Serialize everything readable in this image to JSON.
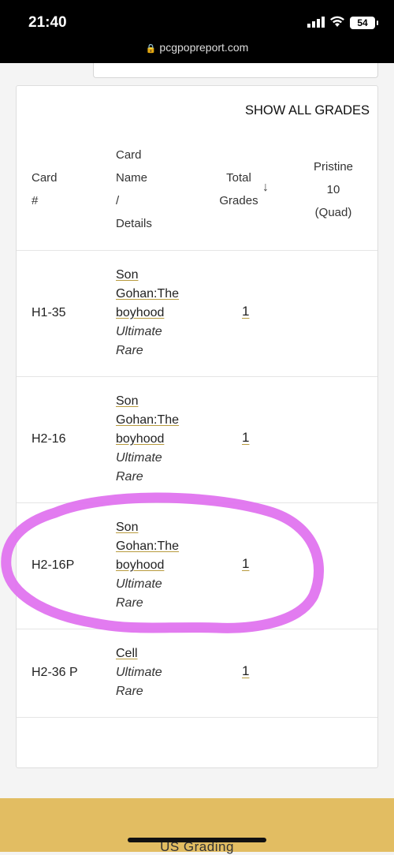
{
  "status_bar": {
    "time": "21:40",
    "battery": "54"
  },
  "browser": {
    "url": "pcgpopreport.com"
  },
  "table": {
    "show_all_label": "SHOW ALL GRADES",
    "headers": {
      "card_no": [
        "Card",
        "#"
      ],
      "name": [
        "Card",
        "Name",
        "/",
        "Details"
      ],
      "total": [
        "Total",
        "Grades"
      ],
      "pristine": [
        "Pristine",
        "10",
        "(Quad)"
      ]
    },
    "rows": [
      {
        "card_no": "H1-35",
        "name_lines": [
          "Son",
          "Gohan:The",
          "boyhood"
        ],
        "rarity_lines": [
          "Ultimate",
          "Rare"
        ],
        "total": "1"
      },
      {
        "card_no": "H2-16",
        "name_lines": [
          "Son",
          "Gohan:The",
          "boyhood"
        ],
        "rarity_lines": [
          "Ultimate",
          "Rare"
        ],
        "total": "1"
      },
      {
        "card_no": "H2-16P",
        "name_lines": [
          "Son",
          "Gohan:The",
          "boyhood"
        ],
        "rarity_lines": [
          "Ultimate",
          "Rare"
        ],
        "total": "1"
      },
      {
        "card_no": "H2-36 P",
        "name_lines": [
          "Cell"
        ],
        "rarity_lines": [
          "Ultimate",
          "Rare"
        ],
        "total": "1"
      }
    ]
  },
  "footer": {
    "text": "US Grading"
  },
  "colors": {
    "accent_underline": "#b89b3e",
    "footer_bg": "#e2bd62",
    "highlight": "#e070ef"
  }
}
